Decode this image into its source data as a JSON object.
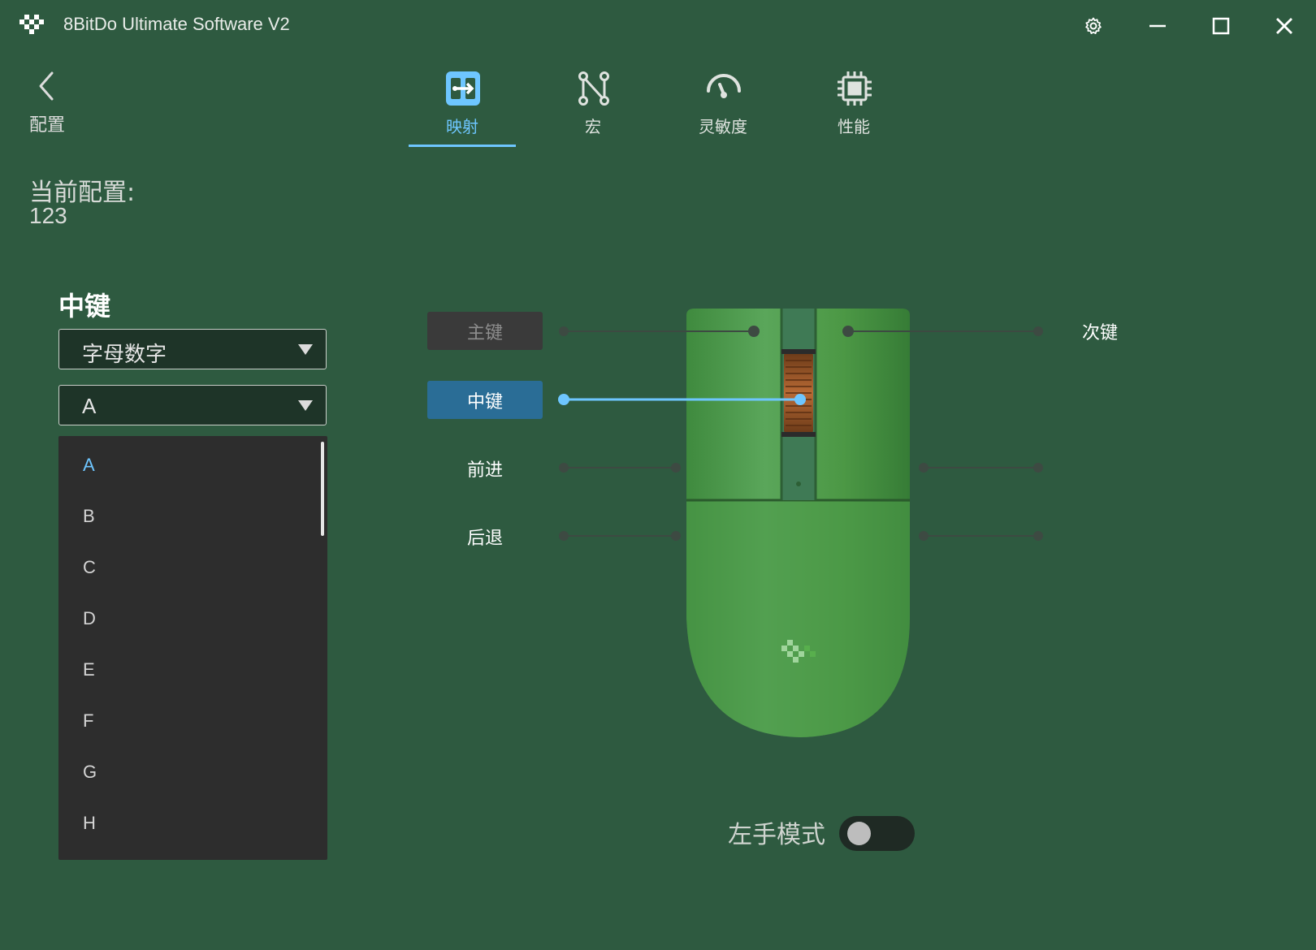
{
  "window": {
    "title": "8BitDo Ultimate Software V2",
    "icons": [
      "logo-icon",
      "gear-icon",
      "minimize-icon",
      "maximize-icon",
      "close-icon"
    ]
  },
  "nav": {
    "back_label": "配置",
    "tabs": [
      {
        "label": "映射",
        "icon": "mapping-icon",
        "active": true
      },
      {
        "label": "宏",
        "icon": "macro-icon",
        "active": false
      },
      {
        "label": "灵敏度",
        "icon": "sensitivity-icon",
        "active": false
      },
      {
        "label": "性能",
        "icon": "chip-icon",
        "active": false
      }
    ]
  },
  "config": {
    "label": "当前配置:",
    "value": "123"
  },
  "editor": {
    "title": "中键",
    "category_select": "字母数字",
    "key_select": "A",
    "key_options": [
      "A",
      "B",
      "C",
      "D",
      "E",
      "F",
      "G",
      "H"
    ],
    "selected_option": "A"
  },
  "mapping": {
    "primary": "主键",
    "middle": "中键",
    "forward": "前进",
    "back": "后退",
    "secondary": "次键"
  },
  "left_hand_mode": {
    "label": "左手模式",
    "enabled": false
  },
  "colors": {
    "background": "#2e5a40",
    "accent": "#6ec6ff",
    "active_button": "#2a6d96",
    "list_bg": "#2d2d2d",
    "mouse_green": "#4f9b45"
  }
}
